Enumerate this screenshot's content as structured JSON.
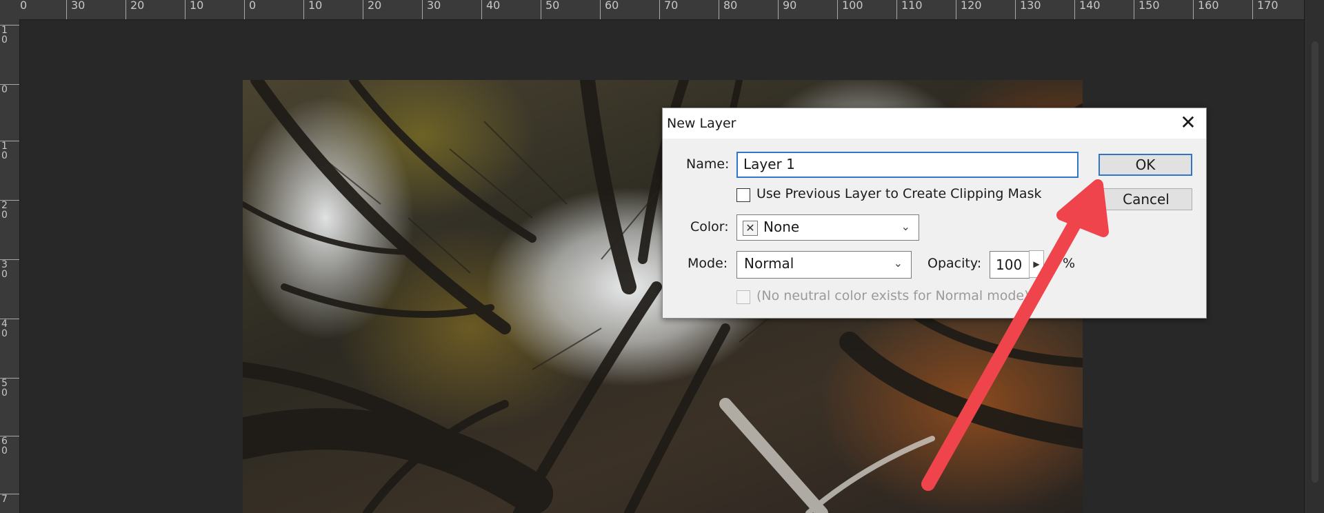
{
  "ruler": {
    "top": [
      "0",
      "30",
      "20",
      "10",
      "0",
      "10",
      "20",
      "30",
      "40",
      "50",
      "60",
      "70",
      "80",
      "90",
      "100",
      "110",
      "120",
      "130",
      "140",
      "150",
      "160",
      "170"
    ],
    "left": [
      "1\n0",
      "0",
      "1\n0",
      "2\n0",
      "3\n0",
      "4\n0",
      "5\n0",
      "6\n0",
      "7"
    ]
  },
  "dialog": {
    "title": "New Layer",
    "close_glyph": "✕",
    "name_label": "Name:",
    "name_value": "Layer 1",
    "clip_label": "Use Previous Layer to Create Clipping Mask",
    "color_label": "Color:",
    "color_value": "None",
    "mode_label": "Mode:",
    "mode_value": "Normal",
    "opacity_label": "Opacity:",
    "opacity_value": "100",
    "opacity_unit": "%",
    "neutral_label": "(No neutral color exists for Normal mode)",
    "ok_label": "OK",
    "cancel_label": "Cancel"
  },
  "colors": {
    "accent": "#2f76c9",
    "annotation_arrow": "#f0444c",
    "workspace": "#282828"
  },
  "icons": {
    "close": "close-icon",
    "color_swatch": "x-swatch-icon",
    "dropdown": "chevron-down-icon",
    "stepper": "triangle-right-icon"
  }
}
